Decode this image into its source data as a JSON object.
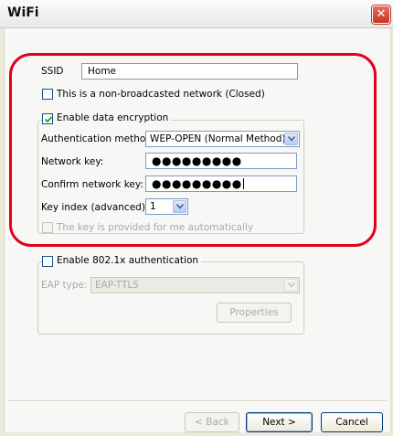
{
  "window": {
    "title": "WiFi"
  },
  "form": {
    "ssid_label": "SSID",
    "ssid_value": "Home",
    "nonbroadcast_label": "This is a non-broadcasted network (Closed)",
    "encryption_group_label": "Enable data encryption",
    "auth_method_label": "Authentication method:",
    "auth_method_value": "WEP-OPEN (Normal Method)",
    "network_key_label": "Network key:",
    "network_key_value": "●●●●●●●●●",
    "confirm_key_label": "Confirm network key:",
    "confirm_key_value": "●●●●●●●●●",
    "key_index_label": "Key index (advanced):",
    "key_index_value": "1",
    "auto_key_label": "The key is provided for me automatically",
    "auth8021x_group_label": "Enable 802.1x authentication",
    "eap_type_label": "EAP type:",
    "eap_type_value": "EAP-TTLS",
    "properties_label": "Properties"
  },
  "buttons": {
    "back": "< Back",
    "next": "Next >",
    "cancel": "Cancel"
  },
  "checkboxes": {
    "nonbroadcast": false,
    "encryption": true,
    "auto_key": false,
    "auth8021x": false
  },
  "colors": {
    "annotation": "#e3001b",
    "accent": "#003c74"
  }
}
